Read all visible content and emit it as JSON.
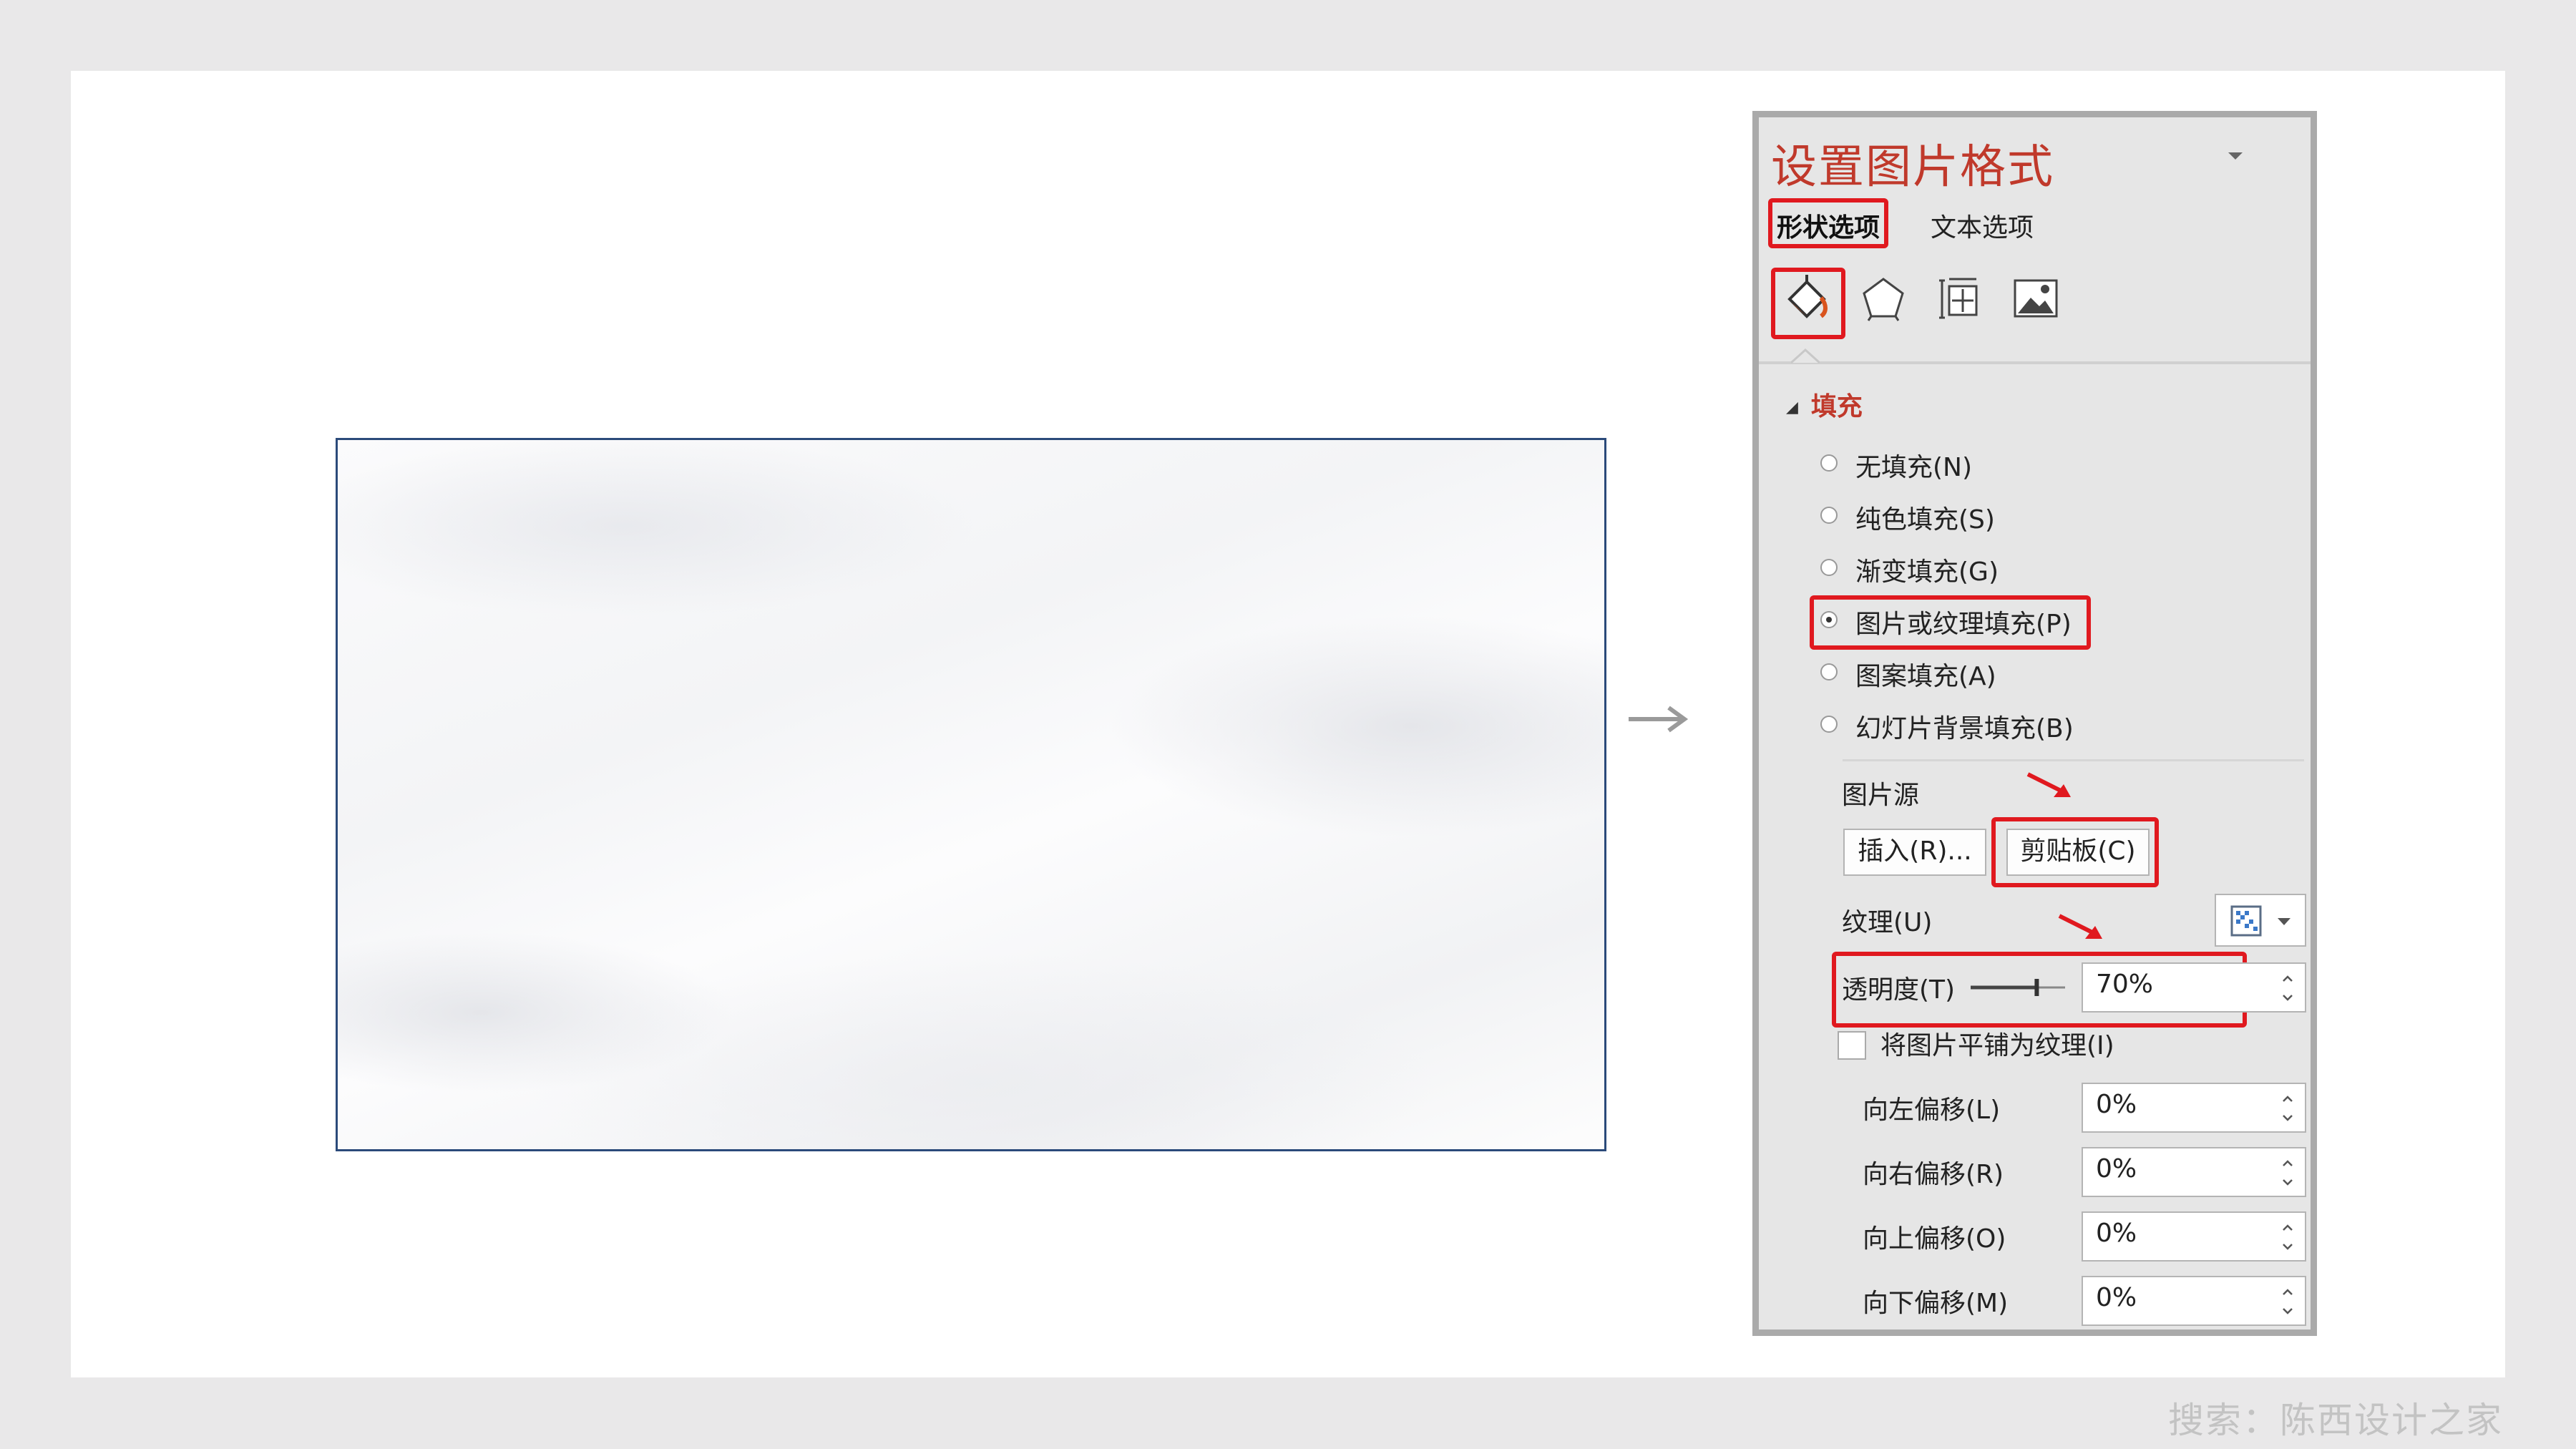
{
  "panel": {
    "title": "设置图片格式",
    "tabs": {
      "shape": "形状选项",
      "text": "文本选项"
    },
    "category_icons": [
      "fill-line-icon",
      "effects-icon",
      "size-properties-icon",
      "picture-icon"
    ],
    "fill_section": "填充",
    "fill_options": [
      {
        "label": "无填充(N)",
        "selected": false
      },
      {
        "label": "纯色填充(S)",
        "selected": false
      },
      {
        "label": "渐变填充(G)",
        "selected": false
      },
      {
        "label": "图片或纹理填充(P)",
        "selected": true
      },
      {
        "label": "图案填充(A)",
        "selected": false
      },
      {
        "label": "幻灯片背景填充(B)",
        "selected": false
      }
    ],
    "picture_source": {
      "label": "图片源",
      "insert_button": "插入(R)...",
      "clipboard_button": "剪贴板(C)"
    },
    "texture_label": "纹理(U)",
    "transparency": {
      "label": "透明度(T)",
      "value": "70%",
      "fraction": 0.7
    },
    "tile_checkbox": {
      "label": "将图片平铺为纹理(I)",
      "checked": false
    },
    "offsets": [
      {
        "label": "向左偏移(L)",
        "value": "0%"
      },
      {
        "label": "向右偏移(R)",
        "value": "0%"
      },
      {
        "label": "向上偏移(O)",
        "value": "0%"
      },
      {
        "label": "向下偏移(M)",
        "value": "0%"
      }
    ]
  },
  "watermark": "搜索：陈西设计之家",
  "colors": {
    "accent_red": "#e0191f",
    "title_red": "#c0392b",
    "panel_bg": "#e6e6e6",
    "picture_border": "#2b4a7a"
  }
}
